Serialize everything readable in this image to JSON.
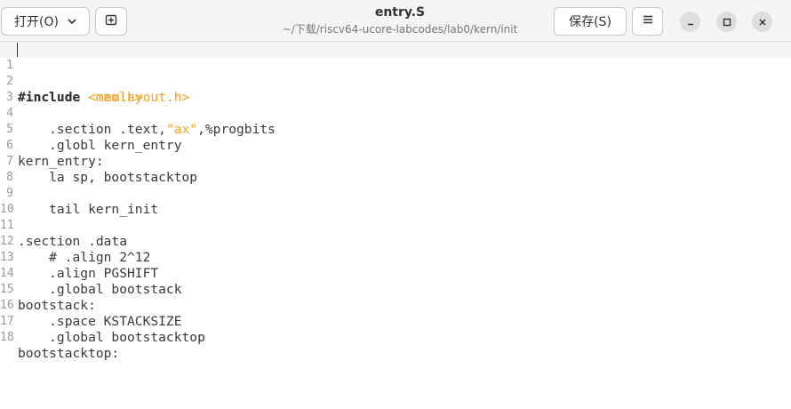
{
  "header": {
    "open_label": "打开(O)",
    "save_label": "保存(S)",
    "title": "entry.S",
    "subtitle": "~/下载/riscv64-ucore-labcodes/lab0/kern/init"
  },
  "icons": {
    "open_dropdown": "chevron-down-icon",
    "new_tab": "new-tab-icon",
    "menu": "hamburger-menu-icon",
    "minimize": "minimize-icon",
    "maximize": "maximize-icon",
    "close": "close-icon"
  },
  "colors": {
    "accent_string": "#f5a01e",
    "header_bg": "#f6f5f4"
  },
  "editor": {
    "current_line": 1,
    "lines": [
      {
        "num": "1",
        "a": "#include",
        "b": " ",
        "c": "<mmu.h>",
        "d": ""
      },
      {
        "num": "2",
        "a": "#include",
        "b": " ",
        "c": "<memlayout.h>",
        "d": ""
      },
      {
        "num": "3",
        "a": "",
        "b": "",
        "c": "",
        "d": ""
      },
      {
        "num": "4",
        "a": "",
        "b": "    .section .text,",
        "c": "\"ax\"",
        "d": ",%progbits"
      },
      {
        "num": "5",
        "a": "",
        "b": "    .globl kern_entry",
        "c": "",
        "d": ""
      },
      {
        "num": "6",
        "a": "",
        "b": "kern_entry:",
        "c": "",
        "d": ""
      },
      {
        "num": "7",
        "a": "",
        "b": "    la sp, bootstacktop",
        "c": "",
        "d": ""
      },
      {
        "num": "8",
        "a": "",
        "b": "",
        "c": "",
        "d": ""
      },
      {
        "num": "9",
        "a": "",
        "b": "    tail kern_init",
        "c": "",
        "d": ""
      },
      {
        "num": "10",
        "a": "",
        "b": "",
        "c": "",
        "d": ""
      },
      {
        "num": "11",
        "a": "",
        "b": ".section .data",
        "c": "",
        "d": ""
      },
      {
        "num": "12",
        "a": "",
        "b": "    # .align 2^12",
        "c": "",
        "d": ""
      },
      {
        "num": "13",
        "a": "",
        "b": "    .align PGSHIFT",
        "c": "",
        "d": ""
      },
      {
        "num": "14",
        "a": "",
        "b": "    .global bootstack",
        "c": "",
        "d": ""
      },
      {
        "num": "15",
        "a": "",
        "b": "bootstack:",
        "c": "",
        "d": ""
      },
      {
        "num": "16",
        "a": "",
        "b": "    .space KSTACKSIZE",
        "c": "",
        "d": ""
      },
      {
        "num": "17",
        "a": "",
        "b": "    .global bootstacktop",
        "c": "",
        "d": ""
      },
      {
        "num": "18",
        "a": "",
        "b": "bootstacktop:",
        "c": "",
        "d": ""
      }
    ]
  }
}
